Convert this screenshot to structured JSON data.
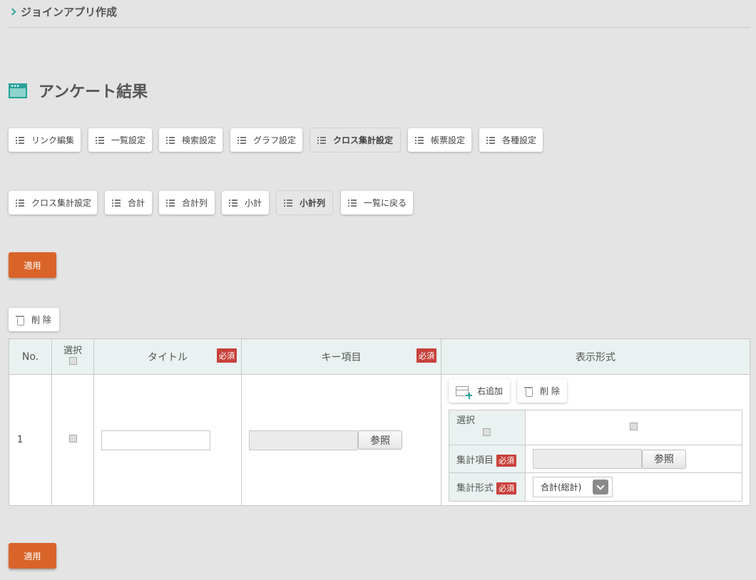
{
  "breadcrumb": {
    "label": "ジョインアプリ作成"
  },
  "page_title": "アンケート結果",
  "tabs_row1": [
    "リンク編集",
    "一覧設定",
    "検索設定",
    "グラフ設定",
    "クロス集計設定",
    "帳票設定",
    "各種設定"
  ],
  "tabs_row1_active": "クロス集計設定",
  "tabs_row2": [
    "クロス集計設定",
    "合計",
    "合計列",
    "小計",
    "小計列",
    "一覧に戻る"
  ],
  "tabs_row2_active": "小計列",
  "apply_label": "適用",
  "delete_label": "削 除",
  "table": {
    "headers": {
      "no": "No.",
      "select": "選択",
      "title": "タイトル",
      "key": "キー項目",
      "display": "表示形式"
    },
    "required_badge": "必須",
    "rows": [
      {
        "no": "1",
        "title_value": "",
        "key_value": "",
        "ref_label": "参照"
      }
    ]
  },
  "display_format": {
    "add_right_label": "右追加",
    "delete_label": "削 除",
    "select_label": "選択",
    "agg_item_label": "集計項目",
    "agg_format_label": "集計形式",
    "agg_item_value": "",
    "ref_label": "参照",
    "agg_format_selected": "合計(総計)"
  },
  "colors": {
    "accent": "#2aa39b",
    "apply": "#d9642a",
    "required": "#c9413b"
  }
}
